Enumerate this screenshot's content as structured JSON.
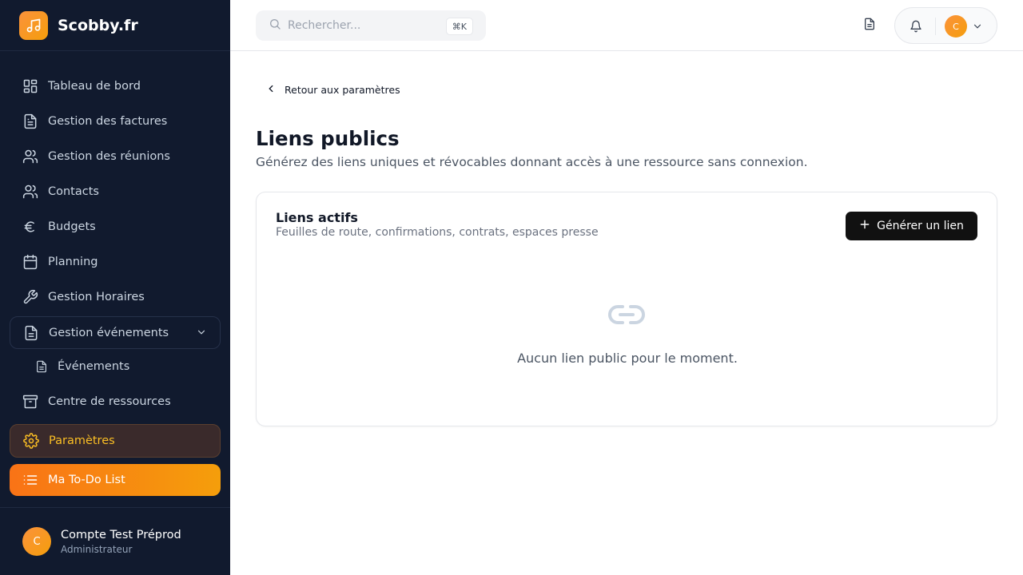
{
  "brand": {
    "name": "Scobby.fr"
  },
  "sidebar": {
    "items": [
      {
        "label": "Tableau de bord"
      },
      {
        "label": "Gestion des factures"
      },
      {
        "label": "Gestion des réunions"
      },
      {
        "label": "Contacts"
      },
      {
        "label": "Budgets"
      },
      {
        "label": "Planning"
      },
      {
        "label": "Gestion Horaires"
      },
      {
        "label": "Gestion événements"
      },
      {
        "label": "Événements"
      },
      {
        "label": "Centre de ressources"
      },
      {
        "label": "Paramètres"
      },
      {
        "label": "Ma To-Do List"
      }
    ],
    "user": {
      "initial": "C",
      "name": "Compte Test Préprod",
      "role": "Administrateur"
    }
  },
  "topbar": {
    "search_placeholder": "Rechercher...",
    "shortcut": "⌘K",
    "avatar_initial": "C"
  },
  "main": {
    "back_label": "Retour aux paramètres",
    "title": "Liens publics",
    "subtitle": "Générez des liens uniques et révocables donnant accès à une ressource sans connexion.",
    "card": {
      "title": "Liens actifs",
      "subtitle": "Feuilles de route, confirmations, contrats, espaces presse",
      "button_label": "Générer un lien",
      "empty_text": "Aucun lien public pour le moment."
    }
  },
  "colors": {
    "sidebar_bg": "#111a2e",
    "accent_orange": "#f97316",
    "accent_amber": "#f59e0b",
    "active_text": "#fbbf24"
  }
}
